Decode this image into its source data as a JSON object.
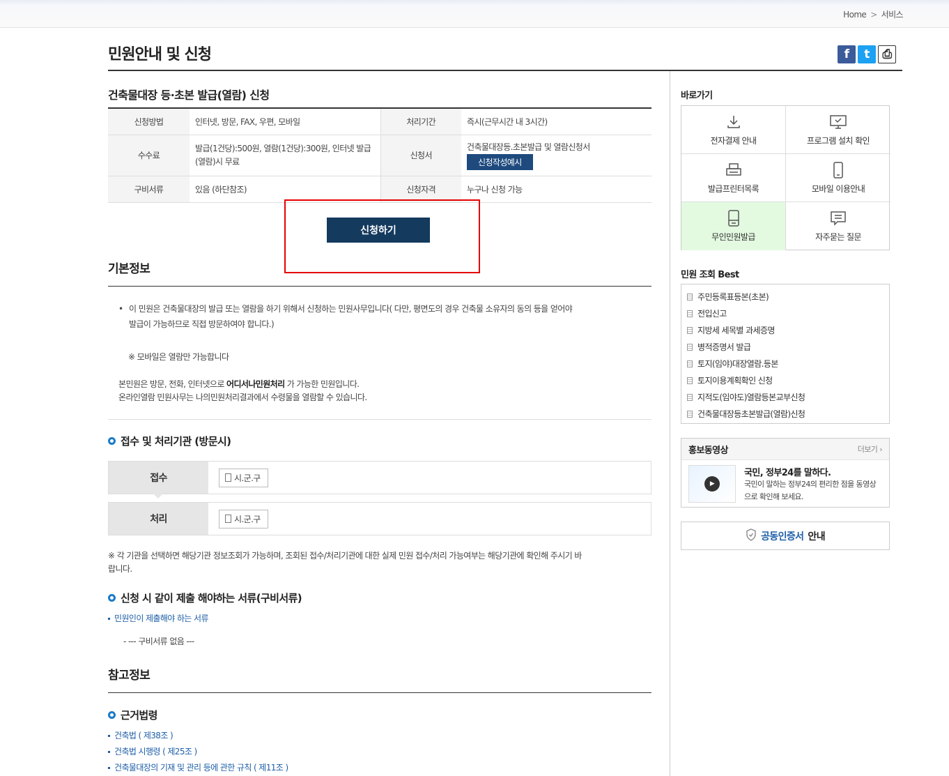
{
  "breadcrumb": {
    "home": "Home",
    "sep": ">",
    "current": "서비스"
  },
  "page_title": "민원안내 및 신청",
  "share": {
    "facebook_icon": "f",
    "twitter_icon": "t",
    "print_icon": "⎙"
  },
  "service": {
    "title": "건축물대장 등·초본 발급(열람) 신청",
    "rows": {
      "method_label": "신청방법",
      "method_value": "인터넷, 방문, FAX, 우편, 모바일",
      "period_label": "처리기간",
      "period_value": "즉시(근무시간 내 3시간)",
      "fee_label": "수수료",
      "fee_value": "발급(1건당):500원, 열람(1건당):300원, 인터넷 발급(열람)시 무료",
      "form_label": "신청서",
      "form_value": "건축물대장등.초본발급 및 열람신청서",
      "form_example": "신청작성예시",
      "docs_label": "구비서류",
      "docs_value": "있음 (하단참조)",
      "qual_label": "신청자격",
      "qual_value": "누구나 신청 가능"
    },
    "apply_button": "신청하기"
  },
  "basic": {
    "title": "기본정보",
    "bullet": "이 민원은 건축물대장의 발급 또는 열람을 하기 위해서 신청하는 민원사무입니다( 다만, 평면도의 경우 건축물 소유자의 동의 등을 얻어야",
    "bullet2": "발급이 가능하므로 직접 방문하여야 합니다.)",
    "mobile_note": "※ 모바일은 열람만 가능합니다",
    "line1_pre": "본민원은 방문, 전화, 인터넷으로 ",
    "line1_bold": "어디서나민원처리",
    "line1_post": " 가 가능한 민원입니다.",
    "line2": "온라인열람 민원사무는 나의민원처리결과에서 수령물을 열람할 수 있습니다."
  },
  "org": {
    "title": "접수 및 처리기관 (방문시)",
    "receive_label": "접수",
    "receive_value": "시.군.구",
    "process_label": "처리",
    "process_value": "시.군.구",
    "note": "※ 각 기관을 선택하면 해당기관 정보조회가 가능하며, 조회된 접수/처리기관에 대한 실제 민원 접수/처리 가능여부는 해당기관에 확인해 주시기 바",
    "note2": "랍니다."
  },
  "required": {
    "title": "신청 시 같이 제출 해야하는 서류(구비서류)",
    "link": "민원인이 제출해야 하는 서류",
    "none": "- --- 구비서류 없음 ---"
  },
  "reference": {
    "title": "참고정보",
    "law_title": "근거법령",
    "laws": [
      "건축법 ( 제38조 )",
      "건축법 시행령 ( 제25조 )",
      "건축물대장의 기재 및 관리 등에 관한 규칙 ( 제11조 )"
    ]
  },
  "side": {
    "shortcut_title": "바로가기",
    "shortcuts": [
      "전자결제 안내",
      "프로그램 설치 확인",
      "발급프린터목록",
      "모바일 이용안내",
      "무인민원발급",
      "자주묻는 질문"
    ],
    "best_title": "민원 조회 Best",
    "best": [
      "주민등록표등본(초본)",
      "전입신고",
      "지방세 세목별 과세증명",
      "병적증명서 발급",
      "토지(임야)대장열람.등본",
      "토지이용계획확인 신청",
      "지적도(임야도)열람등본교부신청",
      "건축물대장등초본발급(열람)신청"
    ],
    "promo_title": "홍보동영상",
    "promo_more": "더보기 ›",
    "promo_head": "국민, 정부24를 말하다.",
    "promo_desc": "국민이 말하는 정부24의 편리한 점을 동영상으로 확인해 보세요.",
    "cert_a": "공동인증서",
    "cert_b": "안내"
  },
  "colors": {
    "accent": "#143a5e",
    "link": "#1e5fa8",
    "highlight": "#e60000",
    "active_tile": "#e3fae0"
  }
}
